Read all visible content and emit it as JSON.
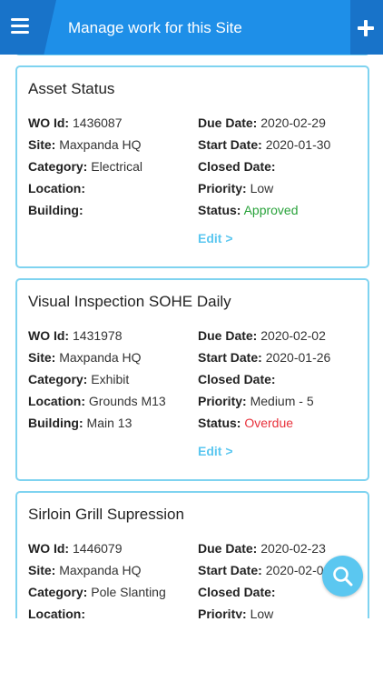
{
  "header": {
    "title": "Manage work for this Site"
  },
  "labels": {
    "wo_id": "WO Id:",
    "site": "Site:",
    "category": "Category:",
    "location": "Location:",
    "building": "Building:",
    "due_date": "Due Date:",
    "start_date": "Start Date:",
    "closed_date": "Closed Date:",
    "priority": "Priority:",
    "status": "Status:"
  },
  "work_orders": [
    {
      "title": "Asset Status",
      "wo_id": "1436087",
      "site": "Maxpanda HQ",
      "category": "Electrical",
      "location": "",
      "building": "",
      "due_date": "2020-02-29",
      "start_date": "2020-01-30",
      "closed_date": "",
      "priority": "Low",
      "status": "Approved",
      "edit_label": "Edit >"
    },
    {
      "title": "Visual Inspection SOHE Daily",
      "wo_id": "1431978",
      "site": "Maxpanda HQ",
      "category": "Exhibit",
      "location": "Grounds M13",
      "building": "Main 13",
      "due_date": "2020-02-02",
      "start_date": "2020-01-26",
      "closed_date": "",
      "priority": "Medium - 5",
      "status": "Overdue",
      "edit_label": "Edit >"
    },
    {
      "title": "Sirloin Grill Supression",
      "wo_id": "1446079",
      "site": "Maxpanda HQ",
      "category": "Pole Slanting",
      "location": "",
      "building": "",
      "due_date": "2020-02-23",
      "start_date": "2020-02-03",
      "closed_date": "",
      "priority": "Low",
      "status": "",
      "edit_label": ""
    }
  ],
  "icons": {
    "menu": "menu-icon",
    "add": "plus-icon",
    "search": "search-icon"
  },
  "colors": {
    "header": "#1e8fe8",
    "header_dark": "#1873c9",
    "card_border": "#7fd3f0",
    "accent": "#5bc7f0",
    "approved": "#28a23a",
    "overdue": "#e8323c"
  }
}
